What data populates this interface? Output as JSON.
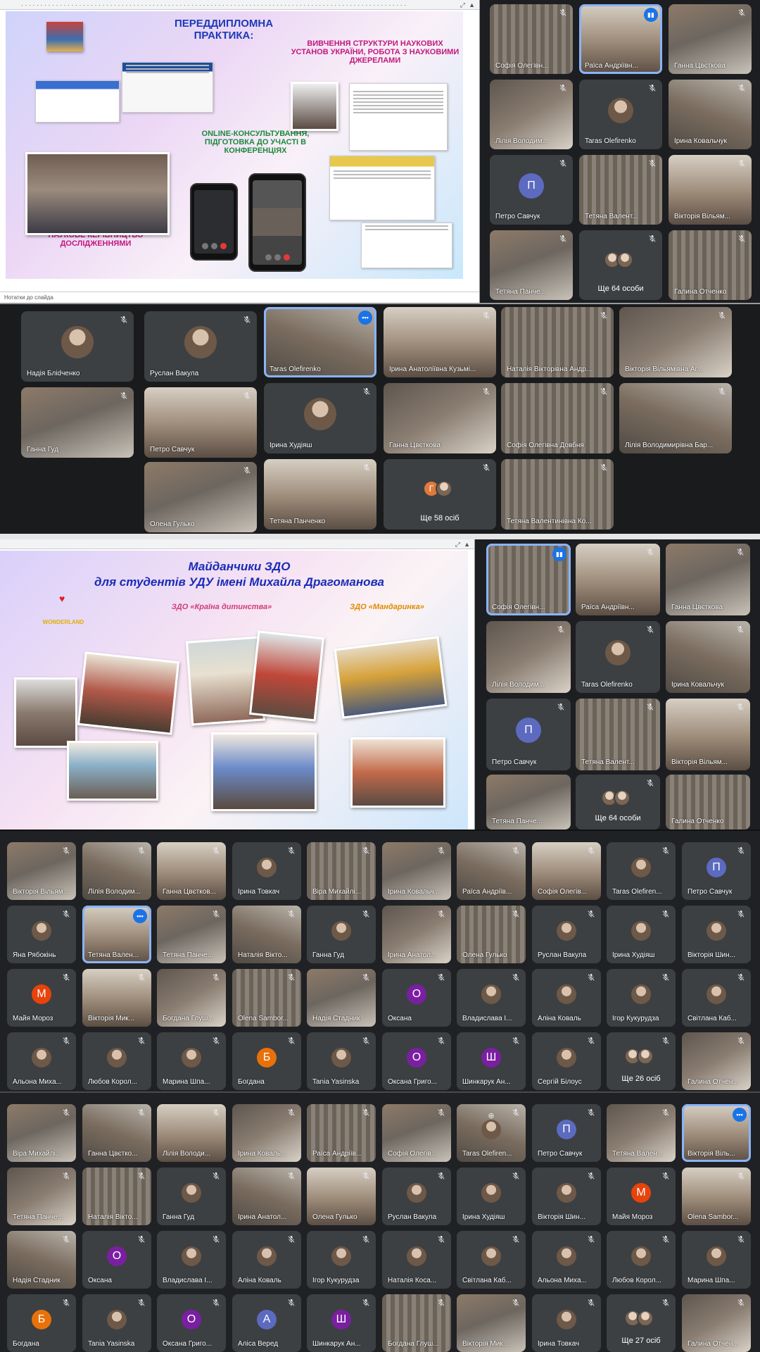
{
  "screens": {
    "s1": {
      "slide": {
        "title": "ПЕРЕДДИПЛОМНА ПРАКТИКА:",
        "subtitle": "ВИВЧЕННЯ СТРУКТУРИ НАУКОВИХ УСТАНОВ УКРАЇНИ, РОБОТА З НАУКОВИМИ ДЖЕРЕЛАМИ",
        "online": "ONLINE-КОНСУЛЬТУВАННЯ, ПІДГОТОВКА ДО УЧАСТІ В КОНФЕРЕНЦІЯХ",
        "lead": "КЕРІВНИЦТВО ПРАКТИКОЮ, НАУКОВЕ КЕРІВНИЦТВО ДОСЛІДЖЕННЯМИ",
        "notes": "Нотатки до слайда"
      },
      "tiles": [
        "Софія Олегівн...",
        "Раїса Андріївн...",
        "Ганна Цвєткова",
        "Лілія Володим...",
        "Taras Olefirenko",
        "Ірина Ковальчук",
        "Петро Савчук",
        "Тетяна Валент...",
        "Вікторія Вільям...",
        "Тетяна Панче...",
        "Галина Отченко"
      ],
      "avatar_p": "П",
      "more": "Ще 64 особи"
    },
    "s2": {
      "tiles": [
        "Надія Бліdченко",
        "Руслан Вакула",
        "Taras Olefirenko",
        "Ірина Анатоліївна Кузьмі...",
        "Наталія Вікторівна Андр...",
        "Вікторія Вільямівна Аг...",
        "Ганна Гуд",
        "Петро Савчук",
        "Ірина Худіяш",
        "Ганна Цвєткова",
        "Софія Олегівна Довбня",
        "Лілія Володимирівна Бар...",
        "Олена Гулько",
        "Тетяна Панченко",
        "Тетяна Валентинівна Ко..."
      ],
      "more": "Ще 58 осіб",
      "avatar_g": "Г"
    },
    "s3": {
      "slide": {
        "title1": "Майданчики ЗДО",
        "title2": "для студентів УДУ імені Михайла Драгоманова",
        "zdo1": "ЗДО «Країна дитинства»",
        "zdo2": "ЗДО «Мандаринка»",
        "logo": "WONDERLAND"
      },
      "tiles": [
        "Софія Олегівн...",
        "Раїса Андріївн...",
        "Ганна Цвєткова",
        "Лілія Володим...",
        "Taras Olefirenko",
        "Ірина Ковальчук",
        "Петро Савчук",
        "Тетяна Валент...",
        "Вікторія Вільям..."
      ],
      "avatar_p": "П",
      "more": "Ще 64 особи"
    },
    "s4": {
      "rows": [
        [
          "Вікторія Вільям...",
          "Лілія Володим...",
          "Ганна Цвєтков...",
          "Ірина Товкач",
          "Віра Михайлі...",
          "Ірина Ковальч...",
          "Раїса Андріїв...",
          "Софія Олегів...",
          "Taras Olefiren...",
          "Петро Савчук"
        ],
        [
          "Яна Рябокінь",
          "Тетяна Вален...",
          "Тетяна Панче...",
          "Наталія Вікто...",
          "Ганна Гуд",
          "Ірина Анатол...",
          "Олена Гулько",
          "Руслан Вакула",
          "Ірина Худіяш",
          "Вікторія Шин..."
        ],
        [
          "Майя Мороз",
          "Вікторія Мик...",
          "Богдана Глуш...",
          "Olena Sambor...",
          "Надія Стадник",
          "Оксана",
          "Владислава І...",
          "Аліна Коваль",
          "Ігор Кукурудза",
          "Світлана Каб..."
        ],
        [
          "Альона Миха...",
          "Любов Корол...",
          "Марина Шпа...",
          "Богдана",
          "Tania Yasinska",
          "Оксана Григо...",
          "Шинкарук Ан...",
          "Сергій Білоус",
          "Ще 26 осіб",
          "Галина Отчен..."
        ]
      ],
      "letters": {
        "p": "П",
        "m": "М",
        "o": "О",
        "b": "Б",
        "sh": "Ш"
      }
    },
    "s5": {
      "rows": [
        [
          "Віра Михайлі...",
          "Ганна Цвєтко...",
          "Лілія Володи...",
          "Ірина Коваль...",
          "Раїса Андріїв...",
          "Софія Олегів...",
          "Taras Olefiren...",
          "Петро Савчук",
          "Тетяна Вален...",
          "Вікторія Віль..."
        ],
        [
          "Тетяна Панче...",
          "Наталія Вікто...",
          "Ганна Гуд",
          "Ірина Анатол...",
          "Олена Гулько",
          "Руслан Вакула",
          "Ірина Худіяш",
          "Вікторія Шин...",
          "Майя Мороз",
          "Olena Sambor..."
        ],
        [
          "Надія Стадник",
          "Оксана",
          "Владислава І...",
          "Аліна Коваль",
          "Ігор Кукурудза",
          "Наталія Коса...",
          "Світлана Каб...",
          "Альона Миха...",
          "Любов Корол...",
          "Марина Шпа..."
        ],
        [
          "Богдана",
          "Tania Yasinska",
          "Оксана Григо...",
          "Аліса Веред",
          "Шинкарук Ан...",
          "Богдана Глуш...",
          "Вікторія Мик...",
          "Ірина Товкач",
          "Ще 27 осіб",
          "Галина Отчен..."
        ]
      ],
      "letters": {
        "p": "П",
        "m": "М",
        "o": "О",
        "b": "Б",
        "sh": "Ш",
        "a": "А"
      }
    }
  },
  "colors": {
    "tile_bg": "#3c4043",
    "speaking": "#1a73e8",
    "avatar_purple": "#7b1fa2",
    "avatar_orange": "#e8710a",
    "avatar_blue": "#5c6bc0",
    "avatar_red": "#e8430a"
  },
  "icons": [
    "mic-off-icon",
    "speaking-icon",
    "pin-icon",
    "more-options-icon"
  ]
}
